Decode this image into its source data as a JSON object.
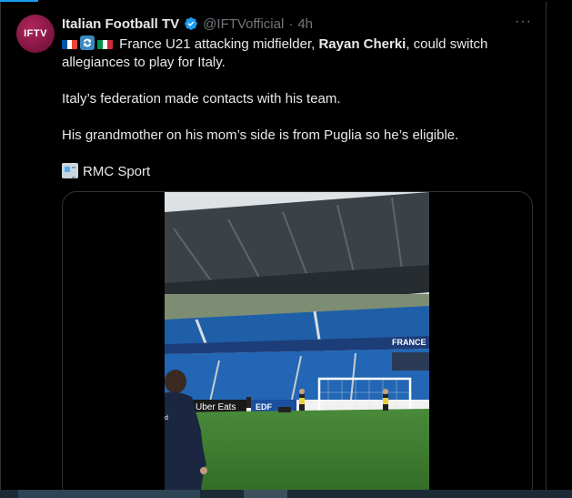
{
  "tweet": {
    "avatar_text": "IFTV",
    "display_name": "Italian Football TV",
    "handle": "@IFTVofficial",
    "separator": "·",
    "time": "4h",
    "more_label": "···",
    "line1_after_emojis": " France U21 attacking midfielder, ",
    "line1_bold": "Rayan Cherki",
    "line1_end": ", could switch allegiances to play for Italy.",
    "paragraph2": "Italy’s federation made contacts with his team.",
    "paragraph3": "His grandmother on his mom’s side is from Puglia so he’s eligible.",
    "source": "RMC Sport"
  },
  "video": {
    "signage": [
      "FRANCE",
      "Uber Eats",
      "EDF"
    ]
  },
  "colors": {
    "accent": "#1d9bf0",
    "text": "#e7e9ea",
    "muted": "#71767b",
    "border": "#2f3336",
    "avatar": "#9e1f50"
  },
  "icons": [
    "verified-badge-icon",
    "france-flag-icon",
    "repeat-arrows-icon",
    "italy-flag-icon",
    "newspaper-icon",
    "more-options-icon"
  ]
}
